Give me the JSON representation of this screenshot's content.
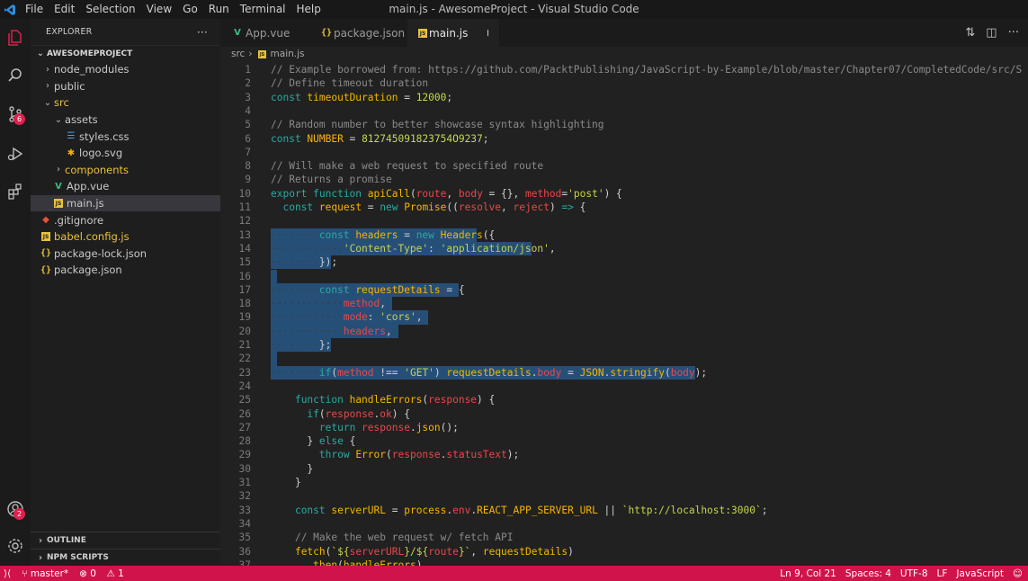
{
  "window": {
    "title": "main.js - AwesomeProject - Visual Studio Code",
    "menu": [
      "File",
      "Edit",
      "Selection",
      "View",
      "Go",
      "Run",
      "Terminal",
      "Help"
    ]
  },
  "activity_bar": {
    "scm_badge": "6",
    "accounts_badge": "2"
  },
  "sidebar": {
    "title": "EXPLORER",
    "more": "···",
    "project": "AWESOMEPROJECT",
    "items": [
      {
        "label": "node_modules",
        "depth": 1,
        "kind": "folder",
        "open": false
      },
      {
        "label": "public",
        "depth": 1,
        "kind": "folder",
        "open": false
      },
      {
        "label": "src",
        "depth": 1,
        "kind": "folder",
        "open": true
      },
      {
        "label": "assets",
        "depth": 2,
        "kind": "folder",
        "open": true
      },
      {
        "label": "styles.css",
        "depth": 3,
        "kind": "css"
      },
      {
        "label": "logo.svg",
        "depth": 3,
        "kind": "svg"
      },
      {
        "label": "components",
        "depth": 2,
        "kind": "folder",
        "open": false
      },
      {
        "label": "App.vue",
        "depth": 2,
        "kind": "vue"
      },
      {
        "label": "main.js",
        "depth": 2,
        "kind": "js",
        "active": true
      },
      {
        "label": ".gitignore",
        "depth": 1,
        "kind": "git"
      },
      {
        "label": "babel.config.js",
        "depth": 1,
        "kind": "js"
      },
      {
        "label": "package-lock.json",
        "depth": 1,
        "kind": "json"
      },
      {
        "label": "package.json",
        "depth": 1,
        "kind": "json"
      }
    ],
    "outline": "OUTLINE",
    "npm_scripts": "NPM SCRIPTS"
  },
  "tabs": [
    {
      "label": "App.vue",
      "kind": "vue",
      "active": false
    },
    {
      "label": "package.json",
      "kind": "json",
      "active": false
    },
    {
      "label": "main.js",
      "kind": "js",
      "active": true,
      "dirty": true
    }
  ],
  "breadcrumb": {
    "folder": "src",
    "file": "main.js"
  },
  "editor": {
    "lines": [
      {
        "n": "1",
        "tokens": [
          [
            "c-com",
            "// Example borrowed from: https://github.com/PacktPublishing/JavaScript-by-Example/blob/master/Chapter07/CompletedCode/src/S"
          ]
        ]
      },
      {
        "n": "2",
        "tokens": [
          [
            "c-com",
            "// Define timeout duration"
          ]
        ]
      },
      {
        "n": "3",
        "tokens": [
          [
            "c-kw",
            "const "
          ],
          [
            "c-var",
            "timeoutDuration"
          ],
          [
            "c-pl",
            " = "
          ],
          [
            "c-num",
            "12000"
          ],
          [
            "c-pl",
            ";"
          ]
        ]
      },
      {
        "n": "4",
        "tokens": []
      },
      {
        "n": "5",
        "tokens": [
          [
            "c-com",
            "// Random number to better showcase syntax highlighting"
          ]
        ]
      },
      {
        "n": "6",
        "tokens": [
          [
            "c-kw",
            "const "
          ],
          [
            "c-var",
            "NUMBER"
          ],
          [
            "c-pl",
            " = "
          ],
          [
            "c-num",
            "812745091823754O9237"
          ],
          [
            "c-pl",
            ";"
          ]
        ]
      },
      {
        "n": "7",
        "tokens": []
      },
      {
        "n": "8",
        "tokens": [
          [
            "c-com",
            "// Will make a web request to specified route"
          ]
        ]
      },
      {
        "n": "9",
        "tokens": [
          [
            "c-com",
            "// Returns a promise"
          ]
        ]
      },
      {
        "n": "10",
        "tokens": [
          [
            "c-kw",
            "export function "
          ],
          [
            "c-fn",
            "apiCall"
          ],
          [
            "c-pl",
            "("
          ],
          [
            "c-param",
            "route"
          ],
          [
            "c-pl",
            ", "
          ],
          [
            "c-param",
            "body"
          ],
          [
            "c-pl",
            " = {}, "
          ],
          [
            "c-param",
            "method"
          ],
          [
            "c-pl",
            "="
          ],
          [
            "c-str",
            "'post'"
          ],
          [
            "c-pl",
            ") {"
          ]
        ]
      },
      {
        "n": "11",
        "tokens": [
          [
            "guide",
            "  "
          ],
          [
            "c-kw",
            "const "
          ],
          [
            "c-var",
            "request"
          ],
          [
            "c-pl",
            " = "
          ],
          [
            "c-kw",
            "new "
          ],
          [
            "c-fn",
            "Promise"
          ],
          [
            "c-pl",
            "(("
          ],
          [
            "c-param",
            "resolve"
          ],
          [
            "c-pl",
            ", "
          ],
          [
            "c-param",
            "reject"
          ],
          [
            "c-pl",
            ") "
          ],
          [
            "c-kw",
            "=>"
          ],
          [
            "c-pl",
            " {"
          ]
        ]
      },
      {
        "n": "12",
        "tokens": []
      },
      {
        "n": "13",
        "sel": 34,
        "tokens": [
          [
            "guide",
            "········"
          ],
          [
            "c-kw",
            "const "
          ],
          [
            "c-var",
            "headers"
          ],
          [
            "c-pl",
            " = "
          ],
          [
            "c-kw",
            "new "
          ],
          [
            "c-fn",
            "Headers"
          ],
          [
            "c-pl",
            "({"
          ]
        ]
      },
      {
        "n": "14",
        "sel": 43,
        "tokens": [
          [
            "guide",
            "············"
          ],
          [
            "c-str",
            "'Content-Type'"
          ],
          [
            "c-pl",
            ": "
          ],
          [
            "c-str",
            "'application/json'"
          ],
          [
            "c-pl",
            ","
          ]
        ]
      },
      {
        "n": "15",
        "sel": 10,
        "tokens": [
          [
            "guide",
            "········"
          ],
          [
            "c-pl",
            "});"
          ]
        ]
      },
      {
        "n": "16",
        "sel": 1,
        "tokens": []
      },
      {
        "n": "17",
        "sel": 31,
        "tokens": [
          [
            "guide",
            "········"
          ],
          [
            "c-kw",
            "const "
          ],
          [
            "c-var",
            "requestDetails"
          ],
          [
            "c-pl",
            " = {"
          ]
        ]
      },
      {
        "n": "18",
        "sel": 20,
        "tokens": [
          [
            "guide",
            "············"
          ],
          [
            "c-obj",
            "method"
          ],
          [
            "c-pl",
            ","
          ]
        ]
      },
      {
        "n": "19",
        "sel": 26,
        "tokens": [
          [
            "guide",
            "············"
          ],
          [
            "c-obj",
            "mode"
          ],
          [
            "c-pl",
            ": "
          ],
          [
            "c-str",
            "'cors'"
          ],
          [
            "c-pl",
            ","
          ]
        ]
      },
      {
        "n": "20",
        "sel": 21,
        "tokens": [
          [
            "guide",
            "············"
          ],
          [
            "c-obj",
            "headers"
          ],
          [
            "c-pl",
            ","
          ]
        ]
      },
      {
        "n": "21",
        "sel": 10,
        "tokens": [
          [
            "guide",
            "········"
          ],
          [
            "c-pl",
            "};"
          ]
        ]
      },
      {
        "n": "22",
        "sel": 1,
        "tokens": []
      },
      {
        "n": "23",
        "sel": 70,
        "tokens": [
          [
            "guide",
            "········"
          ],
          [
            "c-kw",
            "if"
          ],
          [
            "c-pl",
            "("
          ],
          [
            "c-param",
            "method"
          ],
          [
            "c-pl",
            " !== "
          ],
          [
            "c-str",
            "'GET'"
          ],
          [
            "c-pl",
            ") "
          ],
          [
            "c-var",
            "requestDetails"
          ],
          [
            "c-pl",
            "."
          ],
          [
            "c-obj",
            "body"
          ],
          [
            "c-pl",
            " = "
          ],
          [
            "c-var",
            "JSON"
          ],
          [
            "c-pl",
            "."
          ],
          [
            "c-fn",
            "stringify"
          ],
          [
            "c-pl",
            "("
          ],
          [
            "c-param",
            "body"
          ],
          [
            "c-pl",
            ");"
          ]
        ]
      },
      {
        "n": "24",
        "tokens": []
      },
      {
        "n": "25",
        "tokens": [
          [
            "guide",
            "    "
          ],
          [
            "c-kw",
            "function "
          ],
          [
            "c-fn",
            "handleErrors"
          ],
          [
            "c-pl",
            "("
          ],
          [
            "c-param",
            "response"
          ],
          [
            "c-pl",
            ") {"
          ]
        ]
      },
      {
        "n": "26",
        "tokens": [
          [
            "guide",
            "      "
          ],
          [
            "c-kw",
            "if"
          ],
          [
            "c-pl",
            "("
          ],
          [
            "c-param",
            "response"
          ],
          [
            "c-pl",
            "."
          ],
          [
            "c-obj",
            "ok"
          ],
          [
            "c-pl",
            ") {"
          ]
        ]
      },
      {
        "n": "27",
        "tokens": [
          [
            "guide",
            "        "
          ],
          [
            "c-kw",
            "return "
          ],
          [
            "c-param",
            "response"
          ],
          [
            "c-pl",
            "."
          ],
          [
            "c-fn",
            "json"
          ],
          [
            "c-pl",
            "();"
          ]
        ]
      },
      {
        "n": "28",
        "tokens": [
          [
            "guide",
            "      "
          ],
          [
            "c-pl",
            "} "
          ],
          [
            "c-kw",
            "else"
          ],
          [
            "c-pl",
            " {"
          ]
        ]
      },
      {
        "n": "29",
        "tokens": [
          [
            "guide",
            "        "
          ],
          [
            "c-kw",
            "throw "
          ],
          [
            "c-fn",
            "Error"
          ],
          [
            "c-pl",
            "("
          ],
          [
            "c-param",
            "response"
          ],
          [
            "c-pl",
            "."
          ],
          [
            "c-obj",
            "statusText"
          ],
          [
            "c-pl",
            ");"
          ]
        ]
      },
      {
        "n": "30",
        "tokens": [
          [
            "guide",
            "      "
          ],
          [
            "c-pl",
            "}"
          ]
        ]
      },
      {
        "n": "31",
        "tokens": [
          [
            "guide",
            "    "
          ],
          [
            "c-pl",
            "}"
          ]
        ]
      },
      {
        "n": "32",
        "tokens": []
      },
      {
        "n": "33",
        "tokens": [
          [
            "guide",
            "    "
          ],
          [
            "c-kw",
            "const "
          ],
          [
            "c-var",
            "serverURL"
          ],
          [
            "c-pl",
            " = "
          ],
          [
            "c-var",
            "process"
          ],
          [
            "c-pl",
            "."
          ],
          [
            "c-obj",
            "env"
          ],
          [
            "c-pl",
            "."
          ],
          [
            "c-var",
            "REACT_APP_SERVER_URL"
          ],
          [
            "c-pl",
            " || "
          ],
          [
            "c-str",
            "`http://localhost:3000`"
          ],
          [
            "c-pl",
            ";"
          ]
        ]
      },
      {
        "n": "34",
        "tokens": []
      },
      {
        "n": "35",
        "tokens": [
          [
            "guide",
            "    "
          ],
          [
            "c-com",
            "// Make the web request w/ fetch API"
          ]
        ]
      },
      {
        "n": "36",
        "tokens": [
          [
            "guide",
            "    "
          ],
          [
            "c-fn",
            "fetch"
          ],
          [
            "c-pl",
            "("
          ],
          [
            "c-str",
            "`${"
          ],
          [
            "c-param",
            "serverURL"
          ],
          [
            "c-str",
            "}/${"
          ],
          [
            "c-param",
            "route"
          ],
          [
            "c-str",
            "}`"
          ],
          [
            "c-pl",
            ", "
          ],
          [
            "c-var",
            "requestDetails"
          ],
          [
            "c-pl",
            ")"
          ]
        ]
      },
      {
        "n": "37",
        "tokens": [
          [
            "guide",
            "      "
          ],
          [
            "c-pl",
            "."
          ],
          [
            "c-fn",
            "then"
          ],
          [
            "c-pl",
            "("
          ],
          [
            "c-var",
            "handleErrors"
          ],
          [
            "c-pl",
            ")"
          ]
        ]
      }
    ]
  },
  "statusbar": {
    "branch": "master*",
    "errors": "0",
    "warnings": "1",
    "position": "Ln 9, Col 21",
    "spaces": "Spaces: 4",
    "encoding": "UTF-8",
    "eol": "LF",
    "language": "JavaScript"
  }
}
